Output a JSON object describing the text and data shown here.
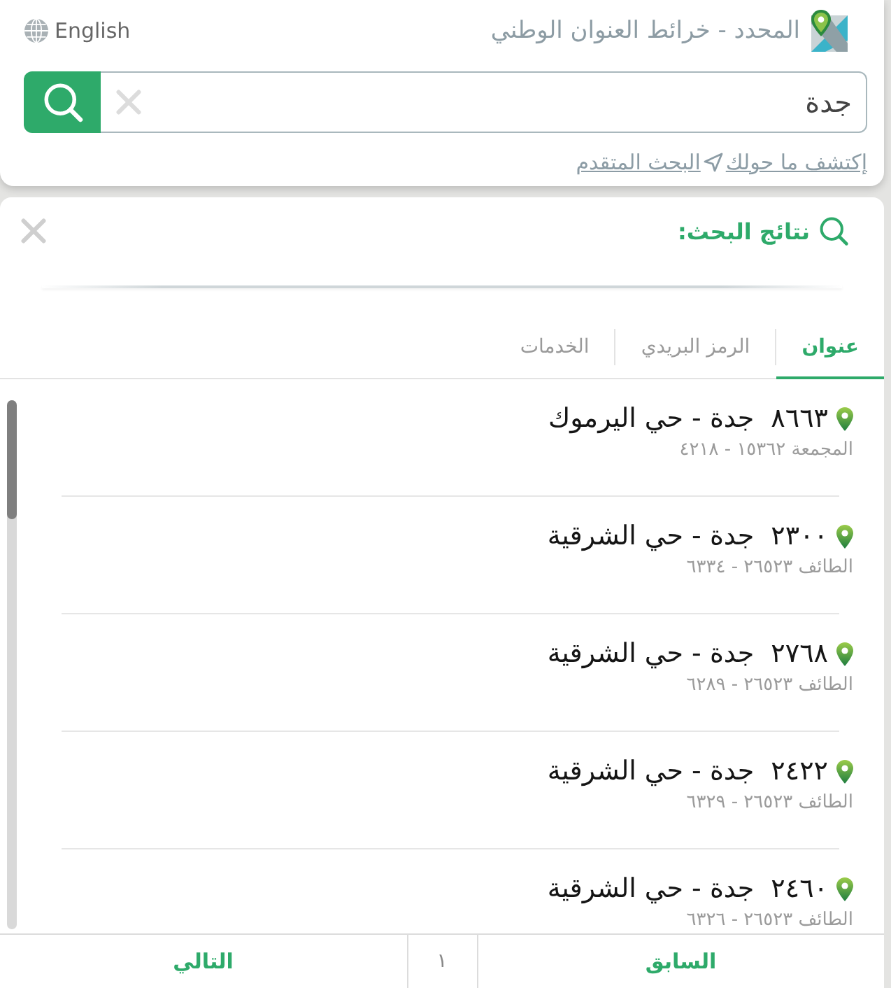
{
  "header": {
    "title": "المحدد - خرائط العنوان الوطني",
    "language": "English"
  },
  "search": {
    "value": "جدة"
  },
  "links": [
    {
      "label": "إكتشف ما حولك"
    },
    {
      "label": "البحث المتقدم"
    }
  ],
  "results_panel": {
    "title": "نتائج البحث:",
    "tabs": [
      {
        "label": "عنوان",
        "selected": true
      },
      {
        "label": "الرمز البريدي",
        "selected": false
      },
      {
        "label": "الخدمات",
        "selected": false
      }
    ],
    "results": [
      {
        "number": "٨٦٦٣",
        "name": "جدة - حي اليرموك",
        "detail": "المجمعة ١٥٣٦٢ - ٤٢١٨"
      },
      {
        "number": "٢٣٠٠",
        "name": "جدة - حي الشرقية",
        "detail": "الطائف ٢٦٥٢٣ - ٦٣٣٤"
      },
      {
        "number": "٢٧٦٨",
        "name": "جدة - حي الشرقية",
        "detail": "الطائف ٢٦٥٢٣ - ٦٢٨٩"
      },
      {
        "number": "٢٤٢٢",
        "name": "جدة - حي الشرقية",
        "detail": "الطائف ٢٦٥٢٣ - ٦٣٢٩"
      },
      {
        "number": "٢٤٦٠",
        "name": "جدة - حي الشرقية",
        "detail": "الطائف ٢٦٥٢٣ - ٦٣٢٦"
      }
    ],
    "pagination": {
      "previous": "السابق",
      "page": "١",
      "next": "التالي"
    }
  }
}
